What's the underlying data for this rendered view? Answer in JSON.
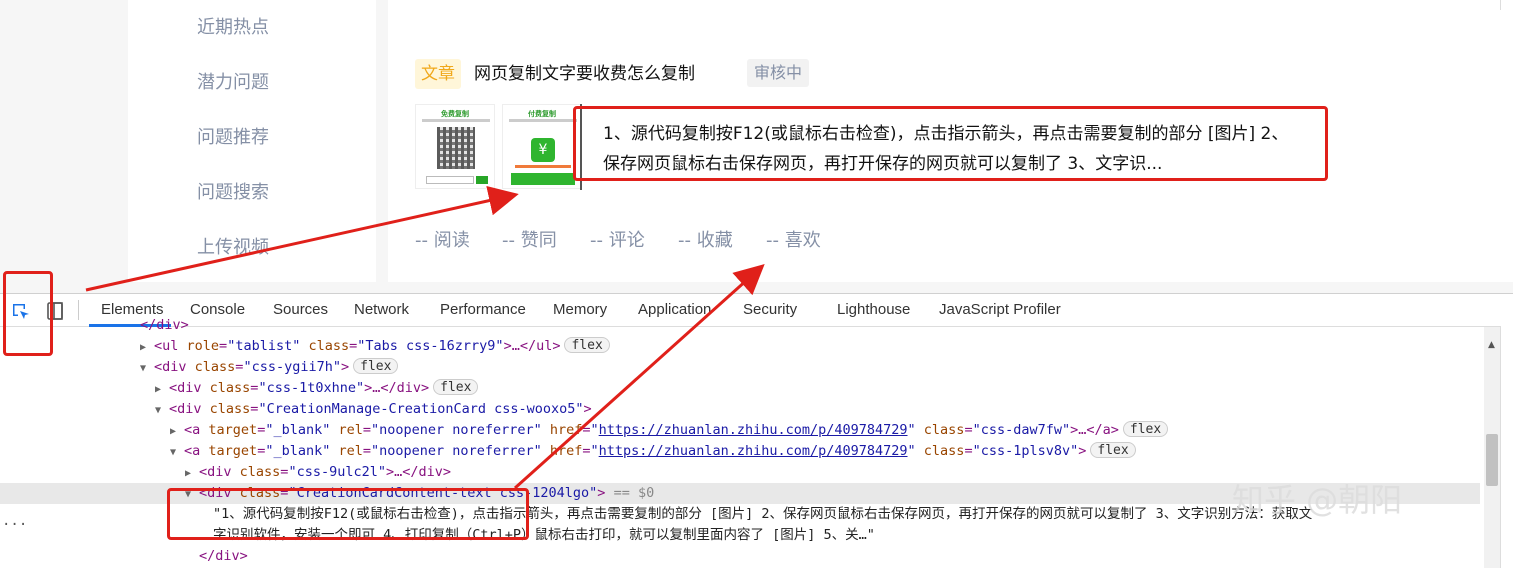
{
  "sidebar": {
    "items": [
      "近期热点",
      "潜力问题",
      "问题推荐",
      "问题搜索",
      "上传视频"
    ]
  },
  "card": {
    "type_tag": "文章",
    "title": "网页复制文字要收费怎么复制",
    "status": "审核中",
    "excerpt": "1、源代码复制按F12(或鼠标右击检查)，点击指示箭头，再点击需要复制的部分 [图片] 2、保存网页鼠标右击保存网页，再打开保存的网页就可以复制了 3、文字识...",
    "thumbnails": {
      "free_label": "免费复制",
      "paid_label": "付费复制",
      "yen": "¥"
    },
    "actions": [
      "-- 阅读",
      "-- 赞同",
      "-- 评论",
      "-- 收藏",
      "-- 喜欢"
    ]
  },
  "devtools": {
    "tabs": [
      "Elements",
      "Console",
      "Sources",
      "Network",
      "Performance",
      "Memory",
      "Application",
      "Security",
      "Lighthouse",
      "JavaScript Profiler"
    ],
    "active_tab": "Elements",
    "dots": "...",
    "badges": {
      "flex": "flex"
    },
    "tree": {
      "l0": "</div>",
      "l1": {
        "tag_open": "<ul",
        "a1": "role",
        "v1": "\"tablist\"",
        "a2": "class",
        "v2": "\"Tabs css-16zrry9\"",
        "tail": ">…</ul>"
      },
      "l2": {
        "tag_open": "<div",
        "a1": "class",
        "v1": "\"css-ygii7h\"",
        "tail": ">"
      },
      "l3": {
        "tag_open": "<div",
        "a1": "class",
        "v1": "\"css-1t0xhne\"",
        "tail": ">…</div>"
      },
      "l4": {
        "tag_open": "<div",
        "a1": "class",
        "v1": "\"CreationManage-CreationCard css-wooxo5\"",
        "tail": ">"
      },
      "l5": {
        "tag_open": "<a",
        "a1": "target",
        "v1": "\"_blank\"",
        "a2": "rel",
        "v2": "\"noopener noreferrer\"",
        "a3": "href",
        "href": "https://zhuanlan.zhihu.com/p/409784729",
        "a4": "class",
        "v4": "\"css-daw7fw\"",
        "tail": ">…</a>"
      },
      "l6": {
        "tag_open": "<a",
        "a1": "target",
        "v1": "\"_blank\"",
        "a2": "rel",
        "v2": "\"noopener noreferrer\"",
        "a3": "href",
        "href": "https://zhuanlan.zhihu.com/p/409784729",
        "a4": "class",
        "v4": "\"css-1plsv8v\"",
        "tail": ">"
      },
      "l7": {
        "tag_open": "<div",
        "a1": "class",
        "v1": "\"css-9ulc2l\"",
        "tail": ">…</div>"
      },
      "l8": {
        "tag_open": "<div",
        "a1": "class",
        "v1": "\"CreationCardContent-text css-1204lgo\"",
        "tail": ">",
        "dollar": "== $0"
      },
      "l9": "\"1、源代码复制按F12(或鼠标右击检查)，点击指示箭头，再点击需要复制的部分 [图片] 2、保存网页鼠标右击保存网页，再打开保存的网页就可以复制了 3、文字识别方法：获取文",
      "l10": "字识别软件，安装一个即可 4、打印复制（Ctrl+P）鼠标右击打印，就可以复制里面内容了 [图片] 5、关…\"",
      "l11": "</div>"
    }
  },
  "watermark": "知乎 @朝阳",
  "colors": {
    "annotation_red": "#e0201a",
    "zhihu_gray": "#8590a6",
    "tag_yellow": "#f0a81b",
    "devtools_blue": "#1a73e8"
  }
}
